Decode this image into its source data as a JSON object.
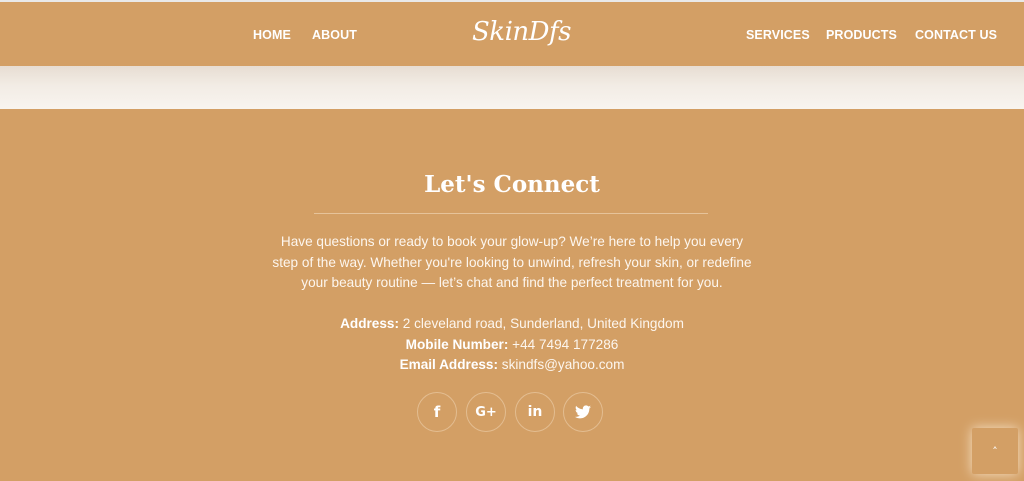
{
  "nav": {
    "home": "HOME",
    "about": "ABOUT",
    "logo": "SkinDfs",
    "services": "SERVICES",
    "products": "PRODUCTS",
    "contact": "CONTACT US"
  },
  "connect": {
    "title": "Let's Connect",
    "description_lines": [
      "Have questions or ready to book your glow-up? We’re here to help you every",
      "step of the way. Whether you're looking to unwind, refresh your skin, or redefine",
      "your beauty routine — let’s chat and find the perfect treatment for you."
    ],
    "address_label": "Address:",
    "address_value": " 2 cleveland road, Sunderland, United Kingdom",
    "mobile_label": "Mobile Number:",
    "mobile_value": " +44 7494 177286",
    "email_label": "Email Address:",
    "email_value": " skindfs@yahoo.com"
  },
  "socials": {
    "facebook": "f",
    "google_plus": "G+",
    "linkedin": "in",
    "twitter": "🐦"
  },
  "scroll_top": {
    "icon": "˄"
  },
  "colors": {
    "brand": "#d39f65",
    "cream": "#f2ece5",
    "text": "#ffffff"
  }
}
